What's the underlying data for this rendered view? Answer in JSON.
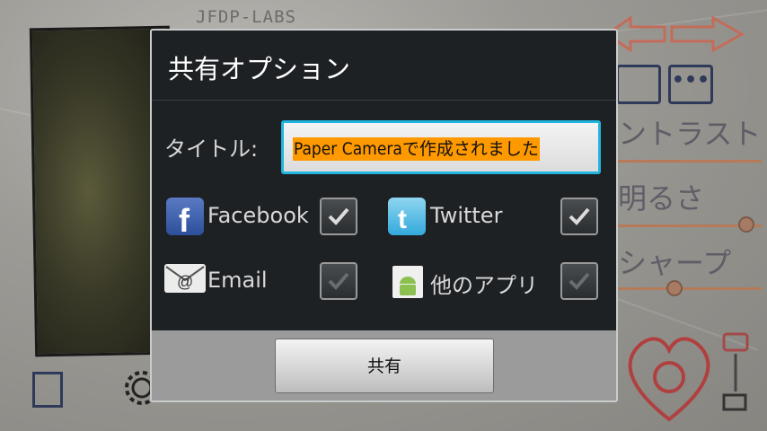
{
  "background": {
    "logo_text": "JFDP-LABS",
    "labels": {
      "contrast": "ントラスト",
      "brightness": "明るさ",
      "sharpness": "シャープ"
    }
  },
  "dialog": {
    "title": "共有オプション",
    "title_field": {
      "label": "タイトル:",
      "value": "Paper Cameraで作成されました"
    },
    "services": [
      {
        "label": "Facebook",
        "icon": "facebook-icon",
        "checked": true
      },
      {
        "label": "Twitter",
        "icon": "twitter-icon",
        "checked": true
      },
      {
        "label": "Email",
        "icon": "email-icon",
        "checked": true
      },
      {
        "label": "他のアプリ",
        "icon": "android-app-icon",
        "checked": true
      }
    ],
    "share_button_label": "共有"
  },
  "colors": {
    "dialog_bg": "#1e2124",
    "input_focus": "#22b5dd",
    "text_highlight": "#ff9900",
    "footer_bg": "#9b9b9b"
  }
}
